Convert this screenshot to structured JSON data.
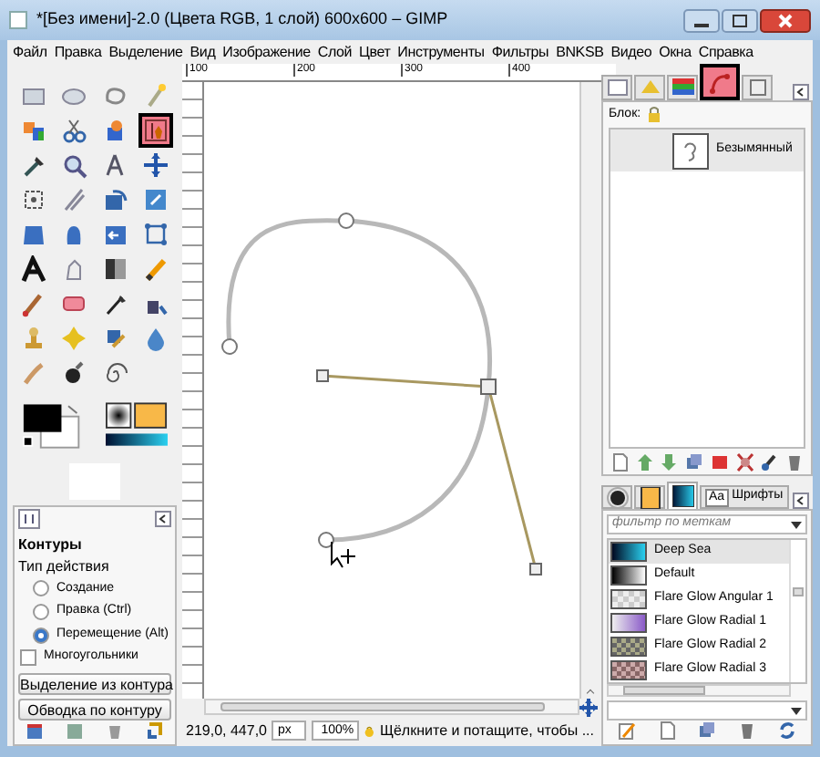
{
  "window": {
    "title": "*[Без имени]-2.0 (Цвета RGB, 1 слой) 600x600 – GIMP"
  },
  "menu": [
    "Файл",
    "Правка",
    "Выделение",
    "Вид",
    "Изображение",
    "Слой",
    "Цвет",
    "Инструменты",
    "Фильтры",
    "BNKSB",
    "Видео",
    "Окна",
    "Справка"
  ],
  "toolbox": {
    "tools": [
      {
        "selected": false
      },
      {
        "selected": false
      },
      {
        "selected": false
      },
      {
        "selected": false
      },
      {
        "selected": false
      },
      {
        "selected": false
      },
      {
        "selected": false
      },
      {
        "selected": true
      },
      {
        "selected": false
      },
      {
        "selected": false
      },
      {
        "selected": false
      },
      {
        "selected": false
      },
      {
        "selected": false
      },
      {
        "selected": false
      },
      {
        "selected": false
      },
      {
        "selected": false
      },
      {
        "selected": false
      },
      {
        "selected": false
      },
      {
        "selected": false
      },
      {
        "selected": false
      },
      {
        "selected": false
      },
      {
        "selected": false
      },
      {
        "selected": false
      },
      {
        "selected": false
      },
      {
        "selected": false
      },
      {
        "selected": false
      },
      {
        "selected": false
      },
      {
        "selected": false
      },
      {
        "selected": false
      },
      {
        "selected": false
      },
      {
        "selected": false
      },
      {
        "selected": false
      },
      {
        "selected": false
      },
      {
        "selected": false
      },
      {
        "selected": false
      }
    ]
  },
  "tool_options": {
    "title": "Контуры",
    "mode_label": "Тип действия",
    "modes": [
      {
        "label": "Создание",
        "selected": false
      },
      {
        "label": "Правка (Ctrl)",
        "selected": false
      },
      {
        "label": "Перемещение (Alt)",
        "selected": true
      }
    ],
    "polygonal": {
      "label": "Многоугольники",
      "checked": false
    },
    "buttons": [
      "Выделение из контура",
      "Обводка по контуру"
    ]
  },
  "ruler": [
    "100",
    "200",
    "300",
    "400"
  ],
  "status_bar": {
    "coords": "219,0, 447,0",
    "unit": "px",
    "zoom": "100%",
    "message": "Щёлкните и потащите, чтобы ..."
  },
  "dock_tabs": [
    {
      "selected": false
    },
    {
      "selected": false
    },
    {
      "selected": false
    },
    {
      "selected": true
    },
    {
      "selected": false
    }
  ],
  "paths": {
    "lock_label": "Блок:",
    "items": [
      {
        "name": "Безымянный",
        "selected": true
      }
    ]
  },
  "resource_tabs": [
    {
      "kind": "brush",
      "selected": false
    },
    {
      "kind": "pattern",
      "selected": false
    },
    {
      "kind": "gradient",
      "selected": true
    },
    {
      "kind": "font",
      "glyph": "Aa",
      "label": "Шрифты",
      "selected": false
    }
  ],
  "gradients": {
    "placeholder": "фильтр по меткам",
    "items": [
      {
        "name": "Deep Sea",
        "selected": true
      },
      {
        "name": "Default",
        "selected": false
      },
      {
        "name": "Flare Glow Angular 1",
        "selected": false
      },
      {
        "name": "Flare Glow Radial 1",
        "selected": false
      },
      {
        "name": "Flare Glow Radial 2",
        "selected": false
      },
      {
        "name": "Flare Glow Radial 3",
        "selected": false
      }
    ]
  }
}
